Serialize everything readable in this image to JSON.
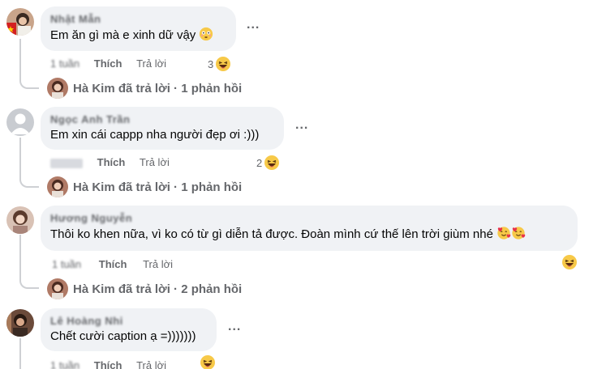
{
  "comments": [
    {
      "author": "Nhật Mẫn",
      "text": "Em ăn gì mà e xinh dữ vậy",
      "time": "1 tuần",
      "like_label": "Thích",
      "reply_label": "Trả lời",
      "reaction_count": "3",
      "more_label": "...",
      "replies_summary": "Hà Kim đã trả lời · 1 phản hồi"
    },
    {
      "author": "Ngọc Anh Trần",
      "text": "Em xin cái cappp nha người đẹp ơi :)))",
      "time": "",
      "like_label": "Thích",
      "reply_label": "Trả lời",
      "reaction_count": "2",
      "more_label": "...",
      "replies_summary": "Hà Kim đã trả lời · 1 phản hồi"
    },
    {
      "author": "Hương Nguyễn",
      "text": "Thôi ko khen nữa, vì ko có từ gì diễn tả được. Đoàn mình cứ thế lên trời giùm nhé",
      "time": "1 tuần",
      "like_label": "Thích",
      "reply_label": "Trả lời",
      "reaction_count": "",
      "more_label": "...",
      "replies_summary": "Hà Kim đã trả lời · 2 phản hồi"
    },
    {
      "author": "Lê Hoàng Nhi",
      "text": "Chết cười caption ạ =)))))))",
      "time": "1 tuần",
      "like_label": "Thích",
      "reply_label": "Trả lời",
      "reaction_count": "",
      "more_label": "..."
    }
  ],
  "colors": {
    "bubble": "#f0f2f5",
    "meta_text": "#65676b",
    "body_text": "#050505",
    "thread_line": "#ced0d4"
  }
}
